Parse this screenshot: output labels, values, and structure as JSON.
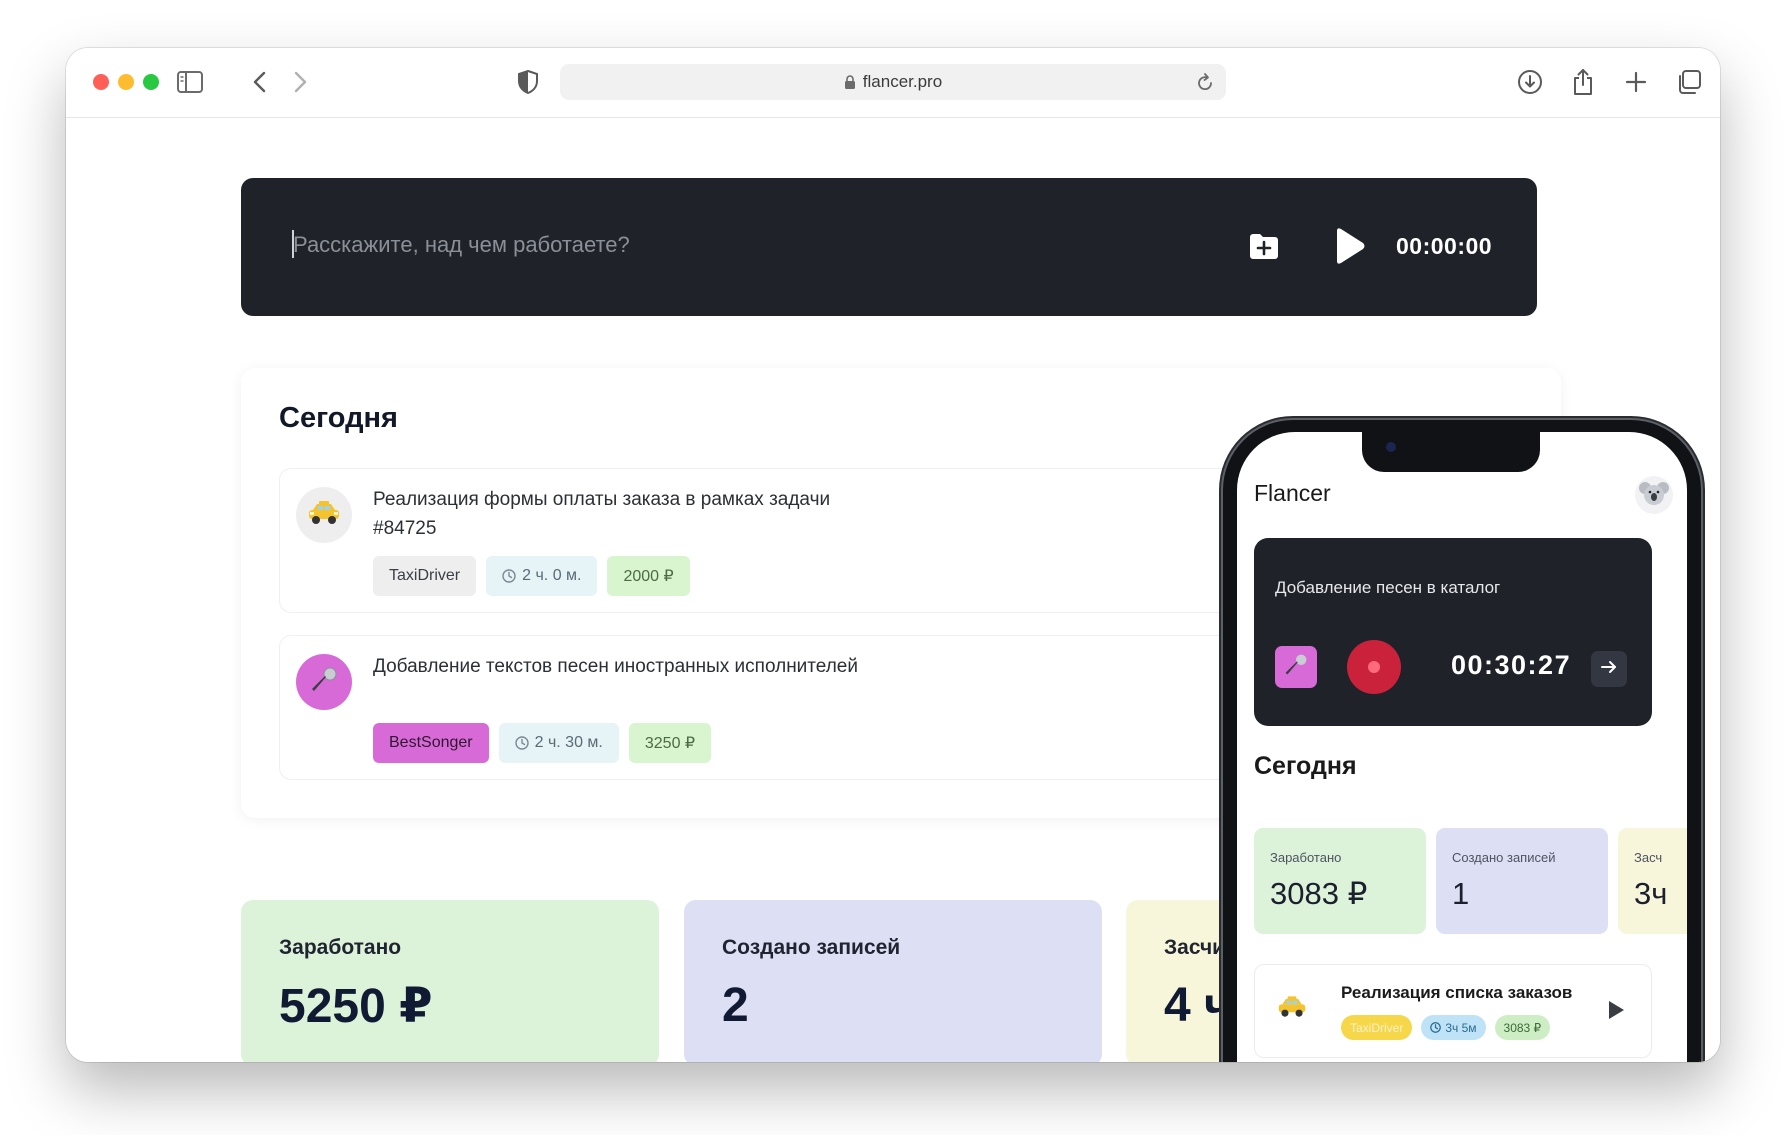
{
  "browser": {
    "url": "flancer.pro"
  },
  "tracker": {
    "placeholder": "Расскажите, над чем работаете?",
    "time": "00:00:00"
  },
  "today": {
    "title": "Сегодня",
    "tasks": [
      {
        "title": "Реализация формы оплаты заказа в рамках задачи #84725",
        "client": "TaxiDriver",
        "duration": "2 ч. 0 м.",
        "amount": "2000 ₽",
        "avatar_icon": "taxi-icon"
      },
      {
        "title": "Добавление текстов песен иностранных исполнителей",
        "client": "BestSonger",
        "duration": "2 ч. 30 м.",
        "amount": "3250 ₽",
        "avatar_icon": "microphone-icon"
      }
    ]
  },
  "stats": [
    {
      "label": "Заработано",
      "value": "5250 ₽"
    },
    {
      "label": "Создано записей",
      "value": "2"
    },
    {
      "label": "Засчи",
      "value": "4 ч"
    }
  ],
  "phone": {
    "brand": "Flancer",
    "tracker": {
      "title": "Добавление песен в каталог",
      "time": "00:30:27"
    },
    "today_title": "Сегодня",
    "stats": [
      {
        "label": "Заработано",
        "value": "3083 ₽"
      },
      {
        "label": "Создано записей",
        "value": "1"
      },
      {
        "label": "Засч",
        "value": "3ч"
      }
    ],
    "task": {
      "title": "Реализация списка заказов",
      "client": "TaxiDriver",
      "duration": "3ч 5м",
      "amount": "3083 ₽"
    }
  },
  "colors": {
    "tracker_bg": "#1f2229",
    "earned_bg": "#dcf3da",
    "records_bg": "#dddff5",
    "counted_bg": "#f8f6da",
    "accent_pink": "#d86ad7",
    "record_red": "#c9223a"
  }
}
